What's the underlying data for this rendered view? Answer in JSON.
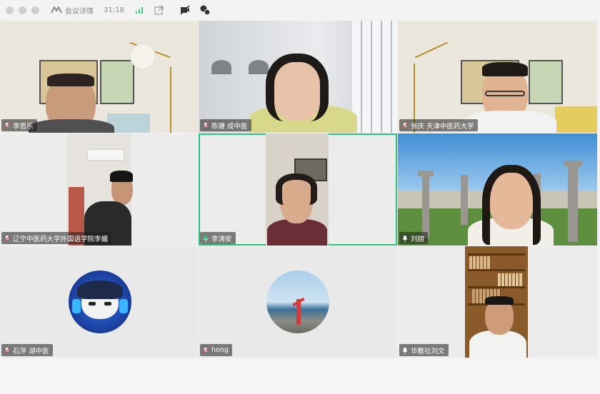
{
  "titlebar": {
    "meeting_label": "会议详情",
    "timer": "31:18",
    "icons": [
      "meeting-logo-icon",
      "signal-icon",
      "share-out-icon",
      "no-video-icon",
      "translate-icon"
    ]
  },
  "participants": [
    {
      "name": "李思乐",
      "mic": "muted"
    },
    {
      "name": "陈骥 成中医",
      "mic": "muted"
    },
    {
      "name": "张庆 天津中医药大学",
      "mic": "muted"
    },
    {
      "name": "辽宁中医药大学外国语学院李媚",
      "mic": "muted"
    },
    {
      "name": "李涛安",
      "mic": "speaking",
      "active": true
    },
    {
      "name": "刘媗",
      "mic": "on"
    },
    {
      "name": "石萍 湖中医",
      "mic": "muted"
    },
    {
      "name": "hong",
      "mic": "muted"
    },
    {
      "name": "华教社刘文",
      "mic": "on"
    }
  ],
  "colors": {
    "active_border": "#29c07a",
    "speaking": "#29c07a"
  }
}
